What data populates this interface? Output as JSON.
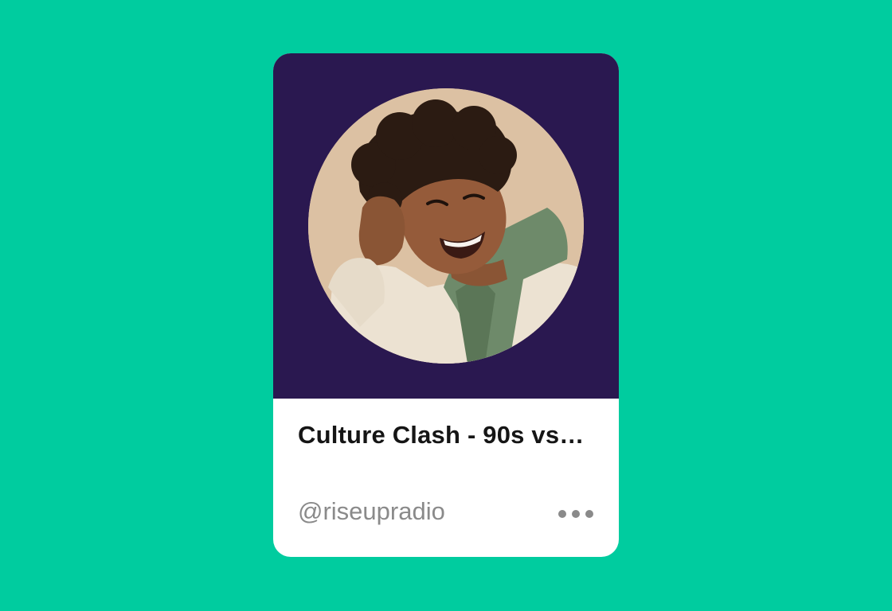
{
  "card": {
    "title": "Culture Clash - 90s vs…",
    "handle": "@riseupradio",
    "more_icon": "more-horizontal-icon"
  },
  "colors": {
    "page_background": "#00cc9f",
    "media_background": "#2a1850",
    "card_background": "#ffffff",
    "title_text": "#151515",
    "secondary_text": "#8a8a8a"
  }
}
